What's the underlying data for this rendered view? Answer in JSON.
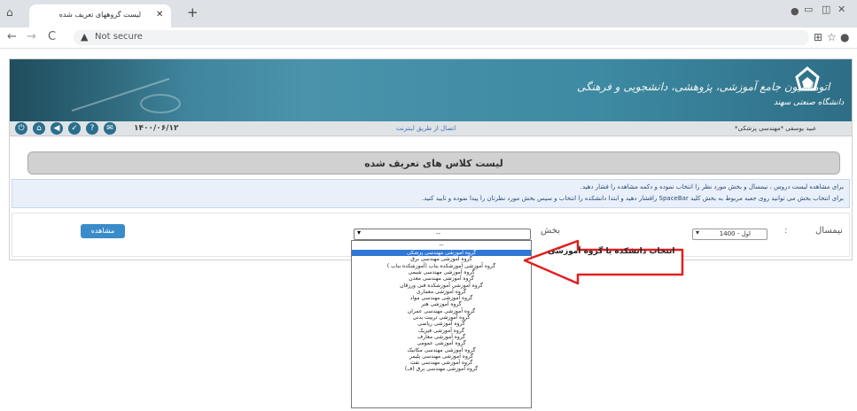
{
  "browser": {
    "tab_title": "لیست گروههای تعریف شده",
    "address": "Not secure",
    "colors": {
      "tabbar": "#dee1e6",
      "omnibox": "#f1f3f4"
    }
  },
  "banner": {
    "title": "اتوماسیون جامع آموزشی، پژوهشی، دانشجویی و فرهنگی",
    "logo_text": "دانشگاه صنعتی سهند"
  },
  "iconbar": {
    "date": "۱۴۰۰/۰۶/۱۲",
    "connection": "اتصال از طریق اینترنت",
    "user": "عبید یوسفی *مهندسی پزشکی*",
    "icons": [
      "power-icon",
      "home-icon",
      "back-icon",
      "check-icon",
      "help-icon",
      "mail-icon"
    ]
  },
  "page": {
    "header": "لیست کلاس های تعریف شده",
    "info_line1": "برای مشاهده لیست دروس ، نیمسال و بخش مورد نظر را انتخاب نموده و دکمه مشاهده را فشار دهید.",
    "info_line2": "برای انتخاب بخش می توانید روی جعبه مربوط به بخش کلید SpaceBar رافشار دهید و ابتدا دانشکده را انتخاب و سپس بخش مورد نظرتان را پیدا نموده و تایید کنید."
  },
  "form": {
    "semester_label": "نیمسال",
    "semester_value": "اول - 1400",
    "department_label": "بخش",
    "department_value": "--",
    "view_button": "مشاهده"
  },
  "dropdown": {
    "first": "--",
    "items": [
      "گروه آموزشی مهندسی پزشکی",
      "گروه آموزشی مهندسی برق",
      "گروه آموزشی آموزشکده بناب (آموزشکده بناب )",
      "گروه آموزشی مهندسی شیمی",
      "گروه آموزشی مهندسی معدن",
      "گروه آموزشی آموزشکده فنی ورزقان",
      "گروه آموزشی معماری",
      "گروه آموزشی مهندسی مواد",
      "گروه آموزشی هنر",
      "گروه آموزشی مهندسی عمران",
      "گروه آموزشی تربیت بدنی",
      "گروه آموزشی ریاضی",
      "گروه آموزشی فیزیک",
      "گروه آموزشی معارف",
      "گروه آموزشی عمومی",
      "گروه آموزشی مهندسی مکانیک",
      "گروه آموزشی مهندسی پلیمر",
      "گروه آموزشی مهندسی نفت",
      "گروه آموزشی مهندسی برق (ف)"
    ],
    "selected_index": 0
  },
  "callout": {
    "text": "انتخاب دانشکده یا گروه آموزشی",
    "color": "#e02020"
  }
}
